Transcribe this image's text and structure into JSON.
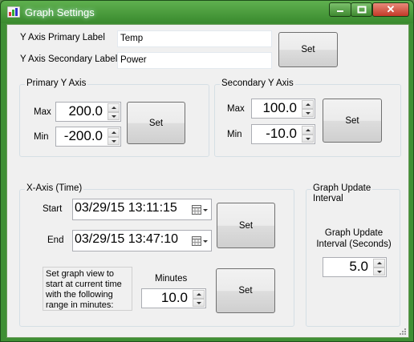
{
  "window": {
    "title": "Graph Settings"
  },
  "labels": {
    "primary_label": "Y Axis Primary Label",
    "secondary_label": "Y Axis Secondary Label",
    "set_button": "Set"
  },
  "inputs": {
    "primary_value": "Temp",
    "secondary_value": "Power"
  },
  "primary_axis": {
    "title": "Primary Y Axis",
    "max_label": "Max",
    "max_value": "200.0",
    "min_label": "Min",
    "min_value": "-200.0",
    "set_button": "Set"
  },
  "secondary_axis": {
    "title": "Secondary Y Axis",
    "max_label": "Max",
    "max_value": "100.0",
    "min_label": "Min",
    "min_value": "-10.0",
    "set_button": "Set"
  },
  "xaxis": {
    "title": "X-Axis (Time)",
    "start_label": "Start",
    "start_value": "03/29/15 13:11:15",
    "end_label": "End",
    "end_value": "03/29/15 13:47:10",
    "set_button": "Set",
    "range_note": [
      "Set graph view to",
      "start at current time",
      "with the following",
      "range in minutes:"
    ],
    "minutes_label": "Minutes",
    "minutes_value": "10.0",
    "set_range_button": "Set"
  },
  "update": {
    "title_line1": "Graph Update",
    "title_line2": "Interval",
    "label_line1": "Graph Update",
    "label_line2": "Interval (Seconds)",
    "value": "5.0"
  },
  "colors": {
    "titlebar": "#3f8f34",
    "close": "#c43a28",
    "client": "#f0f0f0"
  }
}
